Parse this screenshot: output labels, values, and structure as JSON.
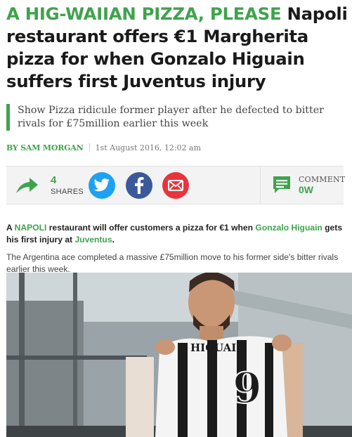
{
  "article": {
    "headline_kicker": "A HIG-WAIIAN PIZZA, PLEASE",
    "headline_rest": "Napoli restaurant offers €1 Margherita pizza for when Gonzalo Higuain suffers first Juventus injury",
    "standfirst": "Show Pizza ridicule former player after he defected to bitter rivals for £75million earlier this week",
    "byline": {
      "author": "BY SAM MORGAN",
      "date": "1st August 2016, 12:02 am"
    },
    "lead": {
      "p1": "A ",
      "link1": "NAPOLI",
      "p2": " restaurant will offer customers a pizza for €1 when ",
      "link2": "Gonzalo Higuain",
      "p3": " gets his first injury at ",
      "link3": "Juventus",
      "p4": "."
    },
    "paragraph2": "The Argentina ace completed a massive £75million move to his former side's bitter rivals earlier this week.",
    "photo": {
      "shirt_name": "HIGUAIN",
      "shirt_number": "9"
    }
  },
  "share_bar": {
    "count": "4",
    "count_label": "SHARES",
    "comment_label": "COMMENT",
    "comment_count": "0W",
    "icons": [
      "share-arrow-icon",
      "twitter-icon",
      "facebook-icon",
      "email-icon",
      "comment-icon"
    ]
  },
  "colors": {
    "accent_green": "#3fa34d",
    "twitter_blue": "#1da1f2",
    "facebook_blue": "#3b5998",
    "email_red": "#e8343d"
  }
}
